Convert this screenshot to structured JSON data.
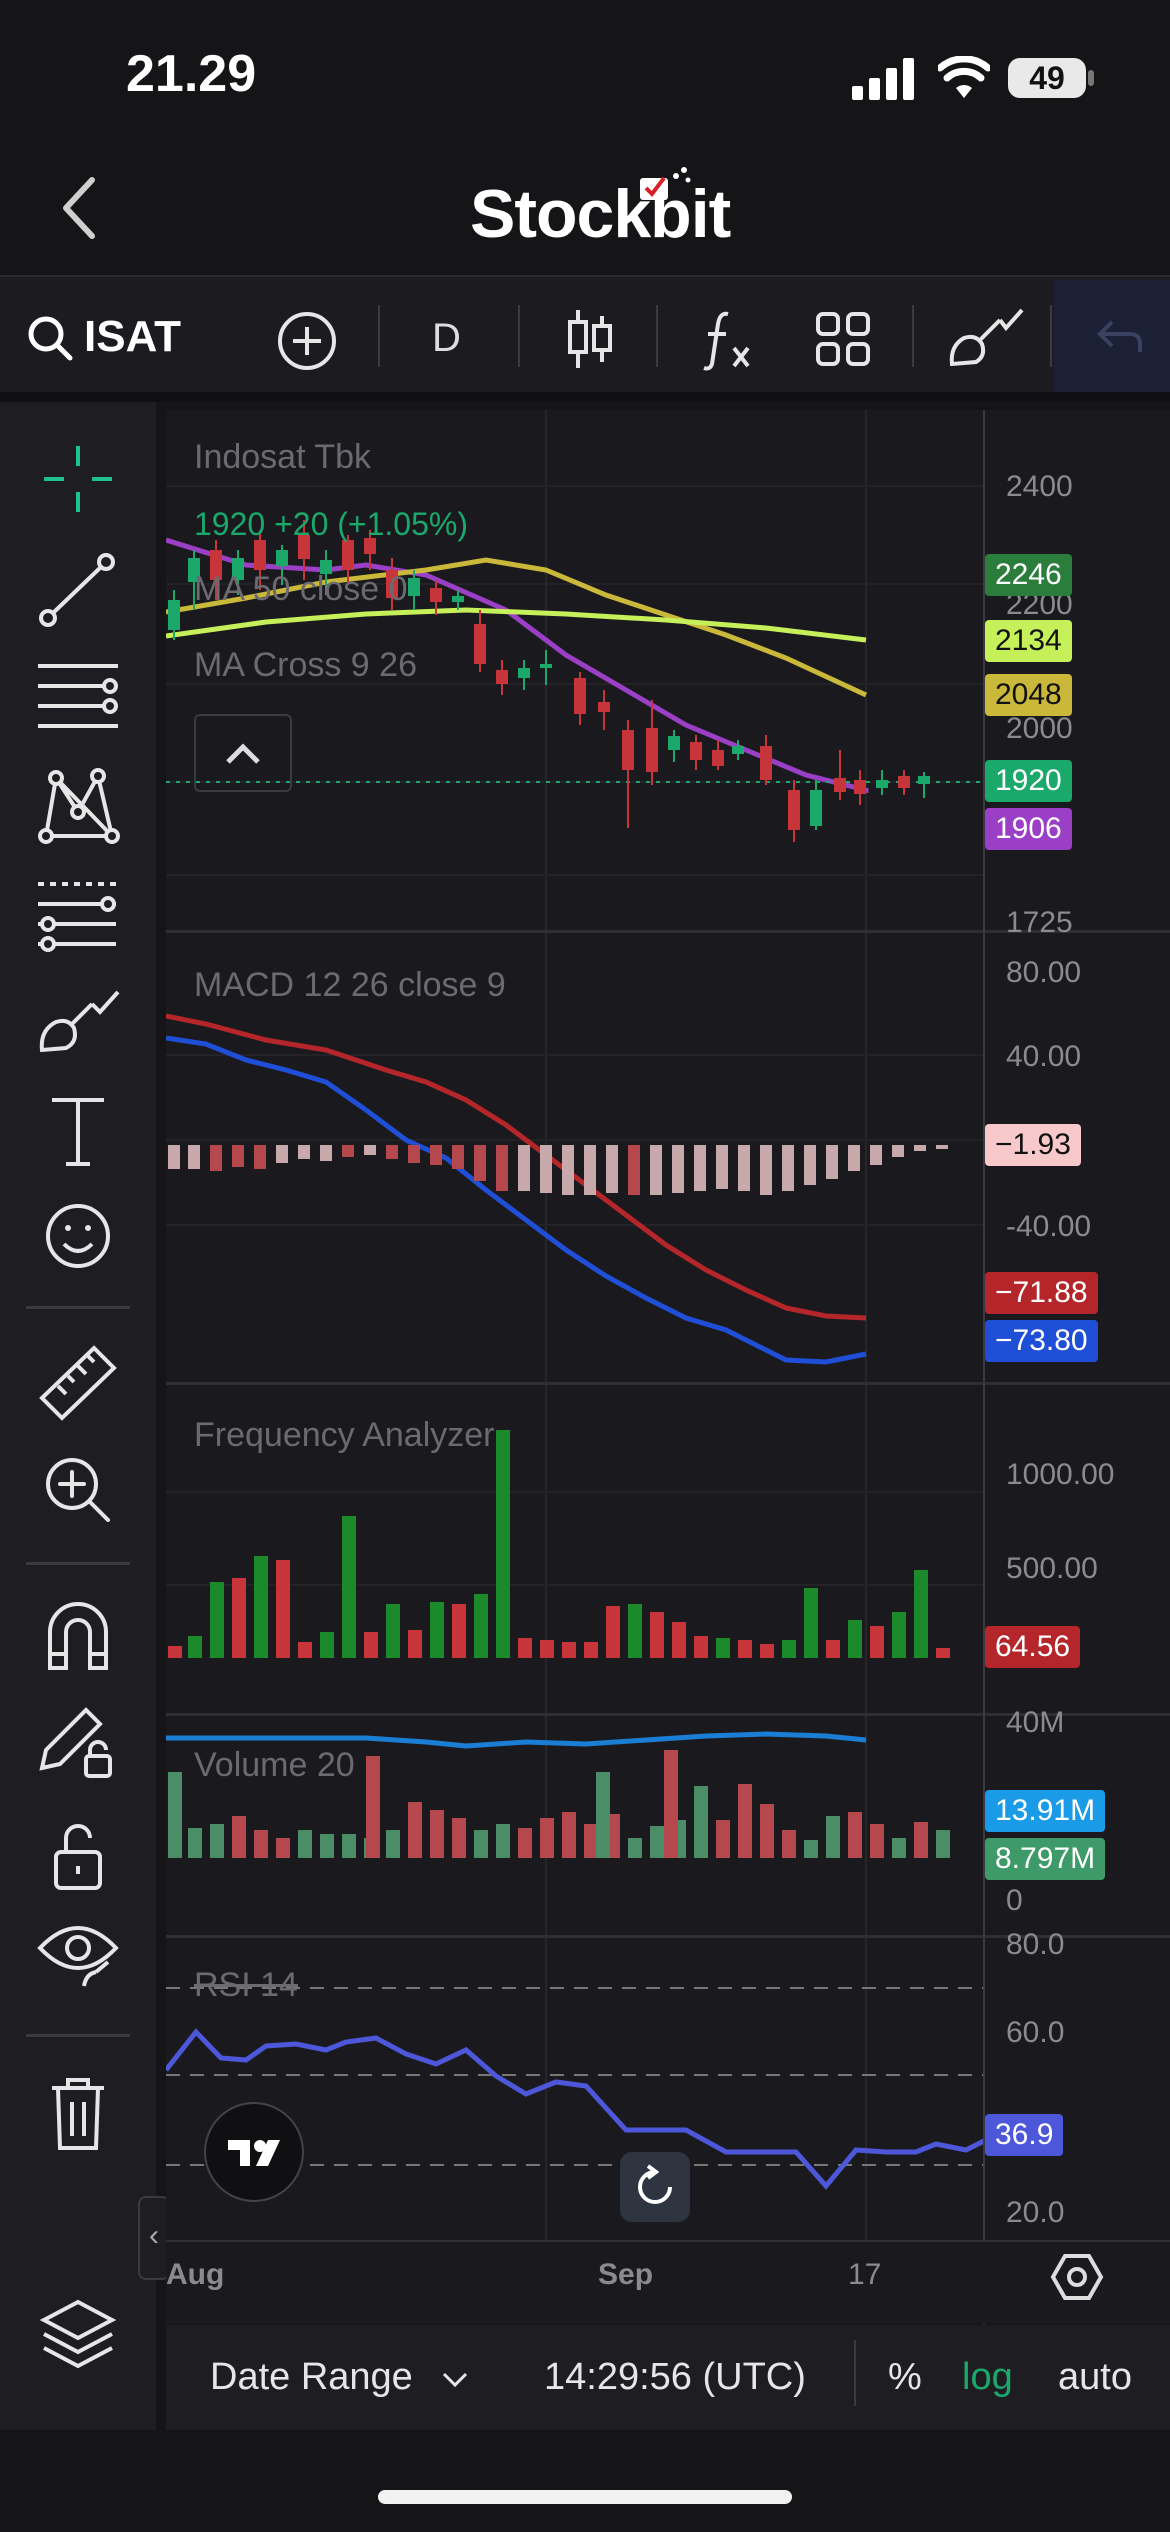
{
  "status_bar": {
    "time": "21.29",
    "battery": "49"
  },
  "header": {
    "brand": "Stockbit"
  },
  "toolbar": {
    "symbol": "ISAT",
    "interval": "D"
  },
  "chart": {
    "title": "Indosat Tbk",
    "price_line": "1920  +20 (+1.05%)",
    "ma_label": "MA 50 close 0",
    "ma_cross_label": "MA Cross 9 26",
    "price_axis": [
      "2400",
      "2200",
      "2000",
      "1725"
    ],
    "price_badges": [
      {
        "value": "2246",
        "color": "#2b7d3b"
      },
      {
        "value": "2134",
        "color": "#c6f05a"
      },
      {
        "value": "2048",
        "color": "#c9b83a"
      },
      {
        "value": "1920",
        "color": "#1aa86b"
      },
      {
        "value": "1906",
        "color": "#9b3fc7"
      }
    ],
    "macd": {
      "title": "MACD 12 26 close 9",
      "axis": [
        "80.00",
        "40.00",
        "-40.00"
      ],
      "badges": [
        {
          "value": "−1.93",
          "color": "#f7c9cb"
        },
        {
          "value": "−71.88",
          "color": "#b5262a"
        },
        {
          "value": "−73.80",
          "color": "#1f4fd6"
        }
      ]
    },
    "frequency": {
      "title": "Frequency Analyzer",
      "axis": [
        "1000.00",
        "500.00"
      ],
      "badge": {
        "value": "64.56",
        "color": "#b5262a"
      }
    },
    "volume": {
      "title": "Volume 20",
      "axis": [
        "40M",
        "0"
      ],
      "badges": [
        {
          "value": "13.91M",
          "color": "#1a9be8"
        },
        {
          "value": "8.797M",
          "color": "#3f9a6a"
        }
      ]
    },
    "rsi": {
      "title": "RSI 14",
      "axis": [
        "80.0",
        "60.0",
        "20.0"
      ],
      "badge": {
        "value": "36.9",
        "color": "#4d57d9"
      }
    },
    "time_axis": [
      "Aug",
      "Sep",
      "17"
    ]
  },
  "footer": {
    "date_range": "Date Range",
    "clock": "14:29:56 (UTC)",
    "percent": "%",
    "log": "log",
    "auto": "auto"
  },
  "icons": {
    "toolbar": [
      "search-icon",
      "add-icon",
      "candle-type-icon",
      "indicator-icon",
      "layout-icon",
      "brush-icon",
      "undo-icon"
    ],
    "tools": [
      "crosshair-icon",
      "trend-line-icon",
      "horizontal-lines-icon",
      "pattern-icon",
      "fib-icon",
      "brush-icon",
      "text-icon",
      "emoji-icon",
      "ruler-icon",
      "zoom-in-icon",
      "magnet-icon",
      "lock-drawing-icon",
      "unlock-icon",
      "eye-icon",
      "trash-icon",
      "layers-icon"
    ]
  }
}
